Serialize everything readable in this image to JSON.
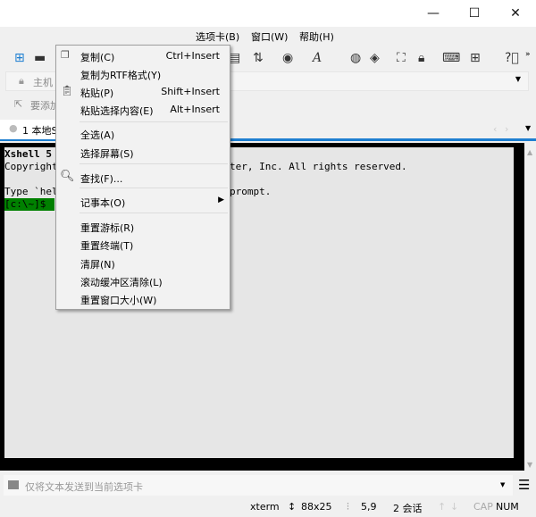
{
  "menubar": {
    "items": [
      "选项卡(B)",
      "窗口(W)",
      "帮助(H)"
    ]
  },
  "address": {
    "placeholder": "主机"
  },
  "hint": {
    "text": "要添加"
  },
  "tab": {
    "label": "1 本地S"
  },
  "terminal": {
    "lines": [
      "Xshell 5",
      "Copyright",
      "ter, Inc. All rights reserved.",
      "Type `hel",
      "prompt.",
      "[c:\\~]$"
    ]
  },
  "context_menu": {
    "items": [
      {
        "label": "复制(C)",
        "shortcut": "Ctrl+Insert"
      },
      {
        "label": "复制为RTF格式(Y)",
        "shortcut": ""
      },
      {
        "label": "粘贴(P)",
        "shortcut": "Shift+Insert"
      },
      {
        "label": "粘贴选择内容(E)",
        "shortcut": "Alt+Insert"
      },
      {
        "label": "全选(A)",
        "shortcut": ""
      },
      {
        "label": "选择屏幕(S)",
        "shortcut": ""
      },
      {
        "label": "查找(F)...",
        "shortcut": ""
      },
      {
        "label": "记事本(O)",
        "shortcut": ""
      },
      {
        "label": "重置游标(R)",
        "shortcut": ""
      },
      {
        "label": "重置终端(T)",
        "shortcut": ""
      },
      {
        "label": "清屏(N)",
        "shortcut": ""
      },
      {
        "label": "滚动缓冲区清除(L)",
        "shortcut": ""
      },
      {
        "label": "重置窗口大小(W)",
        "shortcut": ""
      }
    ]
  },
  "inputbar": {
    "placeholder": "仅将文本发送到当前选项卡"
  },
  "status": {
    "term": "xterm",
    "size": "88x25",
    "pos": "5,9",
    "sessions": "2 会话",
    "cap": "CAP",
    "num": "NUM"
  },
  "colors": {
    "accent": "#1e7fd1",
    "prompt_bg": "#008000"
  }
}
